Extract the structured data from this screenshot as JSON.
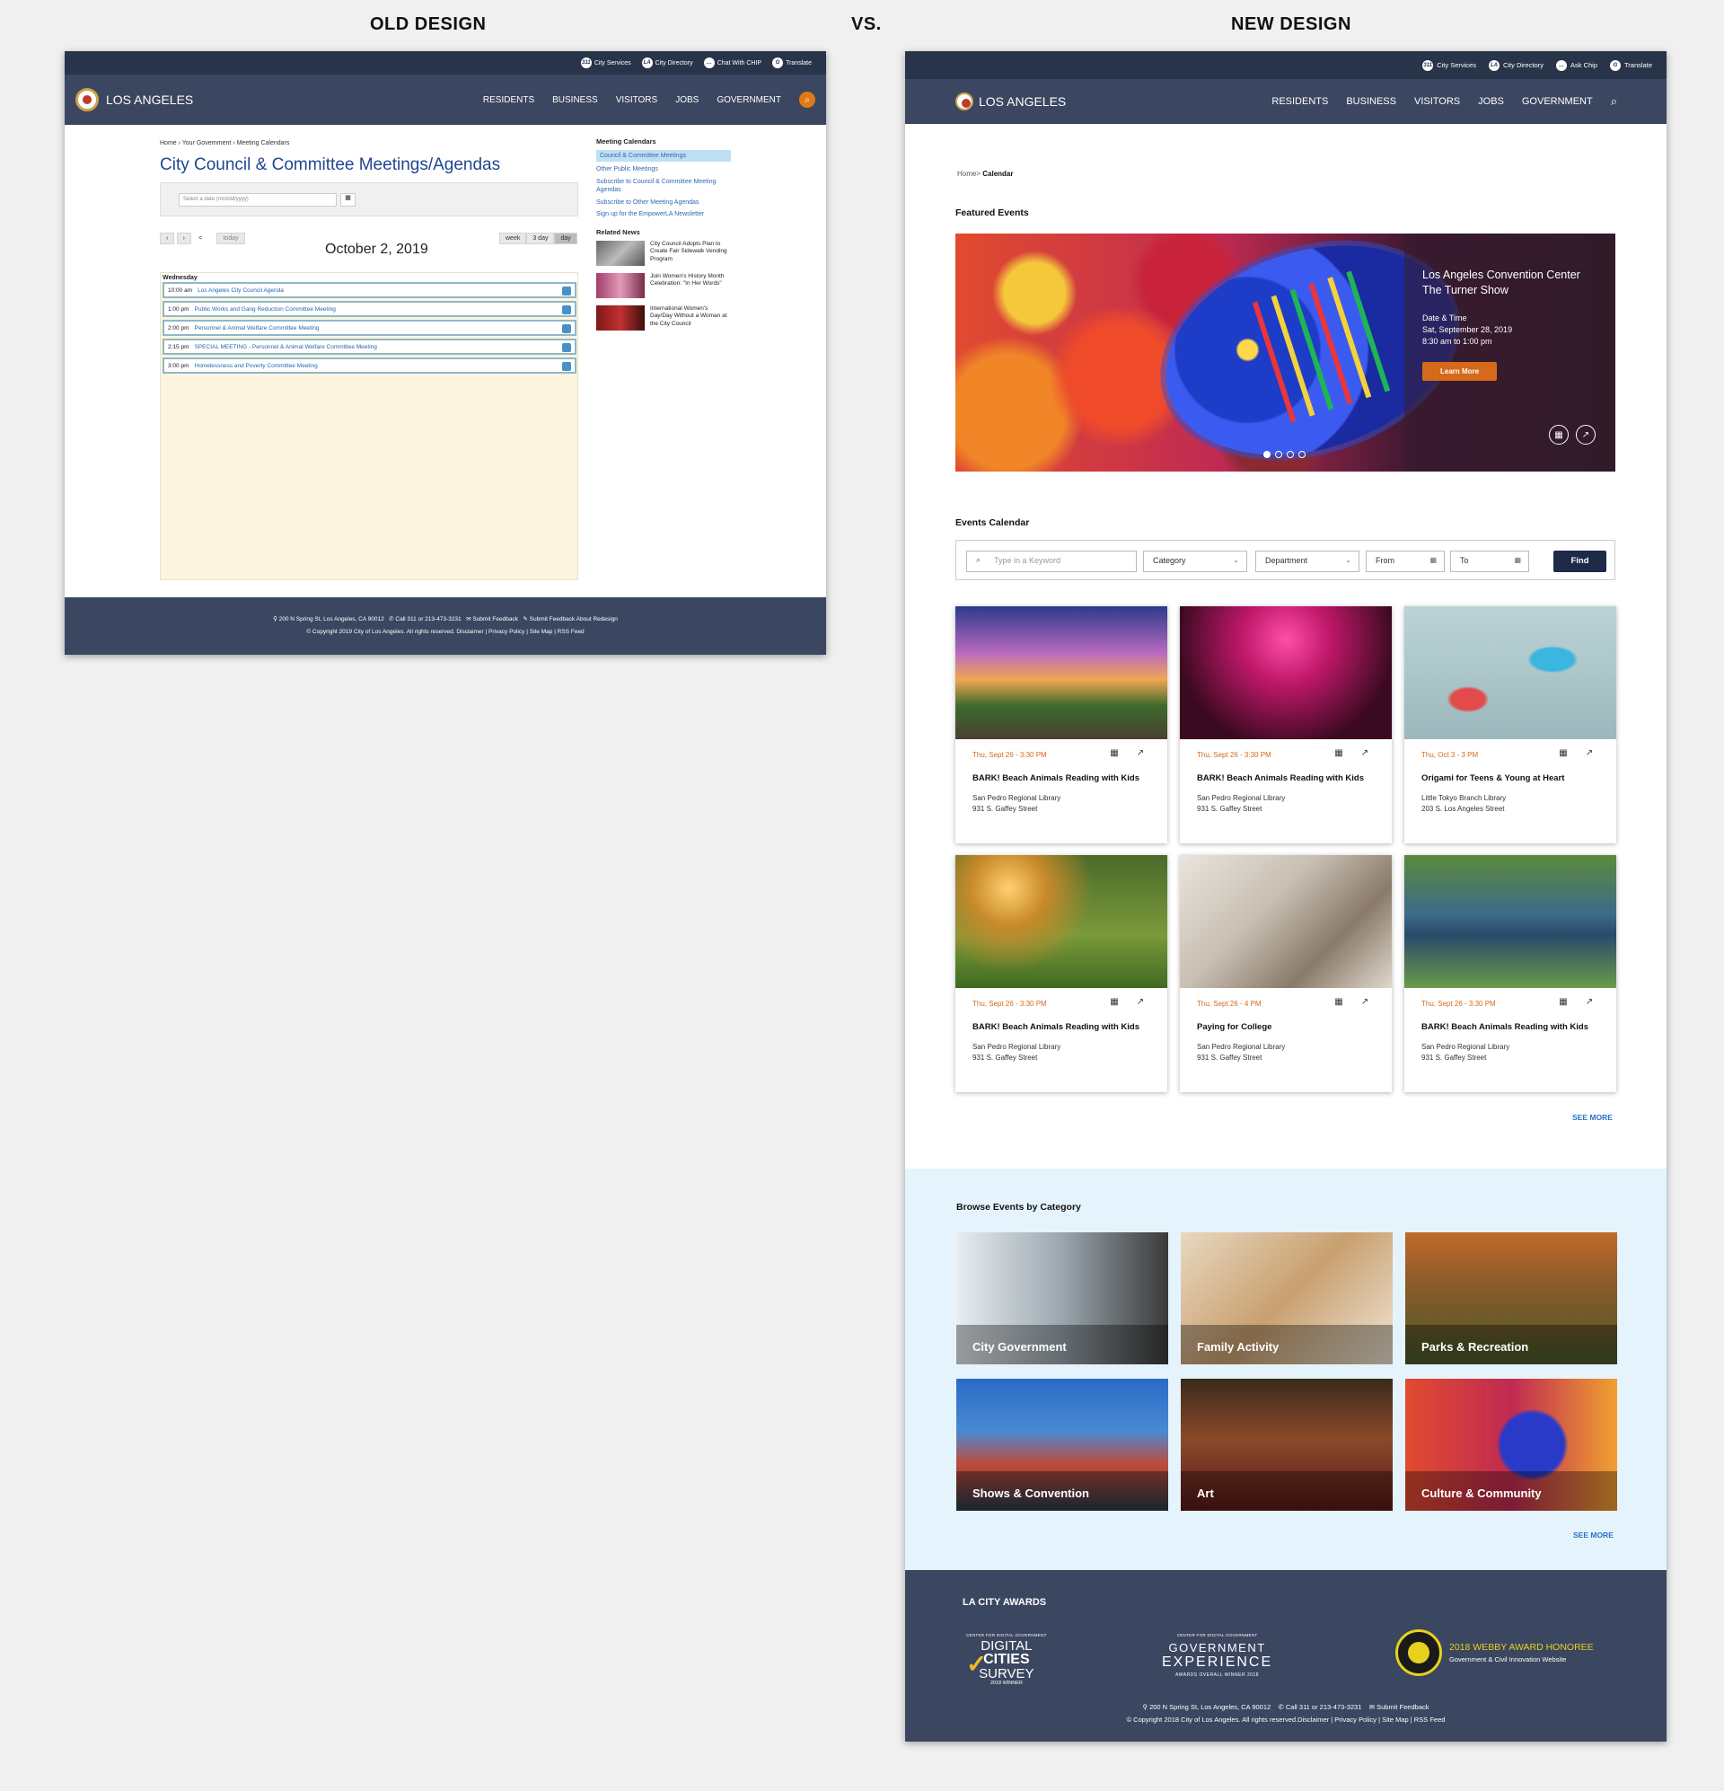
{
  "labels": {
    "old": "OLD DESIGN",
    "vs": "VS.",
    "new": "NEW DESIGN"
  },
  "old": {
    "utility": [
      "City Services",
      "City Directory",
      "Chat With CHIP",
      "Translate"
    ],
    "logo": "LOS ANGELES",
    "nav": [
      "RESIDENTS",
      "BUSINESS",
      "VISITORS",
      "JOBS",
      "GOVERNMENT"
    ],
    "breadcrumb": "Home › Your Government › Meeting Calendars",
    "title": "City Council & Committee Meetings/Agendas",
    "date_placeholder": "Select a date (mm/dd/yyyy)",
    "controls": {
      "prev": "‹",
      "next": "›",
      "share": "<",
      "today": "today",
      "week": "week",
      "three_day": "3 day",
      "day": "day"
    },
    "date": "October 2, 2019",
    "weekday": "Wednesday",
    "events": [
      {
        "time": "10:00 am",
        "name": "Los Angeles City Council Agenda"
      },
      {
        "time": "1:00 pm",
        "name": "Public Works and Gang Reduction Committee Meeting"
      },
      {
        "time": "2:00 pm",
        "name": "Personnel & Animal Welfare Committee Meeting"
      },
      {
        "time": "2:15 pm",
        "name": "SPECIAL MEETING - Personnel & Animal Welfare Committee Meeting"
      },
      {
        "time": "3:00 pm",
        "name": "Homelessness and Poverty Committee Meeting"
      }
    ],
    "sidebar": {
      "heading": "Meeting Calendars",
      "links": [
        "Council & Committee Meetings",
        "Other Public Meetings",
        "Subscribe to Council & Committee Meeting Agendas",
        "Subscribe to Other Meeting Agendas",
        "Sign up for the EmpowerLA Newsletter"
      ],
      "news_heading": "Related News",
      "news": [
        "City Council Adopts Plan to Create Fair Sidewalk Vending Program",
        "Join Women's History Month Celebration: \"In Her Words\"",
        "International Women's Day/Day Without a Woman at the City Council"
      ]
    },
    "footer": {
      "address": "200 N Spring St, Los Angeles, CA 90012",
      "phone": "Call 311 or 213-473-3231",
      "feedback": "Submit Feedback",
      "feedback_redesign": "Submit Feedback About Redesign",
      "copyright": "© Copyright 2019 City of Los Angeles. All rights reserved.  Disclaimer | Privacy Policy | Site Map | RSS Feed"
    }
  },
  "new": {
    "utility": [
      "City Services",
      "City Directory",
      "Ask Chip",
      "Translate"
    ],
    "logo": "LOS ANGELES",
    "nav": [
      "RESIDENTS",
      "BUSINESS",
      "VISITORS",
      "JOBS",
      "GOVERNMENT"
    ],
    "breadcrumb_home": "Home>",
    "breadcrumb_current": "Calendar",
    "featured_title": "Featured Events",
    "hero": {
      "title": "Los Angeles Convention Center The Turner Show",
      "label": "Date & Time",
      "date": "Sat, September 28, 2019",
      "time": "8:30 am to 1:00 pm",
      "button": "Learn More"
    },
    "calendar_title": "Events Calendar",
    "search": {
      "keyword": "Type in a Keyword",
      "category": "Category",
      "department": "Department",
      "from": "From",
      "to": "To",
      "find": "Find"
    },
    "events": [
      {
        "date": "Thu, Sept 26 - 3:30 PM",
        "title": "BARK! Beach Animals Reading with Kids",
        "place": "San Pedro Regional Library",
        "address": "931 S. Gaffey Street"
      },
      {
        "date": "Thu, Sept 26 - 3:30 PM",
        "title": "BARK! Beach Animals Reading with Kids",
        "place": "San Pedro Regional Library",
        "address": "931 S. Gaffey Street"
      },
      {
        "date": "Thu, Oct 3 - 3 PM",
        "title": "Origami for Teens & Young at Heart",
        "place": "Little Tokyo Branch Library",
        "address": "203 S. Los Angeles Street"
      },
      {
        "date": "Thu, Sept 26 - 3:30 PM",
        "title": "BARK! Beach Animals Reading with Kids",
        "place": "San Pedro Regional Library",
        "address": "931 S. Gaffey Street"
      },
      {
        "date": "Thu, Sept 26 - 4 PM",
        "title": "Paying for College",
        "place": "San Pedro Regional Library",
        "address": "931 S. Gaffey Street"
      },
      {
        "date": "Thu, Sept 26 - 3:30 PM",
        "title": "BARK! Beach Animals Reading with Kids",
        "place": "San Pedro Regional Library",
        "address": "931 S. Gaffey Street"
      }
    ],
    "see_more": "SEE MORE",
    "browse_title": "Browse Events by Category",
    "categories": [
      "City Government",
      "Family Activity",
      "Parks & Recreation",
      "Shows & Convention",
      "Art",
      "Culture & Community"
    ],
    "awards_title": "LA CITY AWARDS",
    "awards": {
      "dcs_top": "CENTER FOR DIGITAL GOVERNMENT",
      "dcs_l1": "DIGITAL",
      "dcs_l2": "CITIES",
      "dcs_l3": "SURVEY",
      "dcs_bottom": "2018 WINNER",
      "gx_top": "CENTER FOR DIGITAL GOVERNMENT",
      "gx_l1": "GOVERNMENT",
      "gx_l2": "EXPERIENCE",
      "gx_bottom": "AWARDS OVERALL WINNER 2018",
      "webby_title": "2018 WEBBY AWARD HONOREE",
      "webby_sub": "Government & Civil Innovation Website"
    },
    "footer": {
      "address": "200 N Spring St, Los Angeles, CA 90012",
      "phone": "Call 311 or 213-473-3231",
      "feedback": "Submit Feedback",
      "copyright": "© Copyright 2018 City of Los Angeles. All rights reserved.Disclaimer | Privacy Policy | Site Map | RSS Feed"
    }
  },
  "colors": {
    "nav": "#3b4660",
    "utility": "#283449",
    "accent": "#d46a1a",
    "link": "#2a72c4",
    "find": "#1d2b48",
    "browse_bg": "#e5f4fc"
  }
}
